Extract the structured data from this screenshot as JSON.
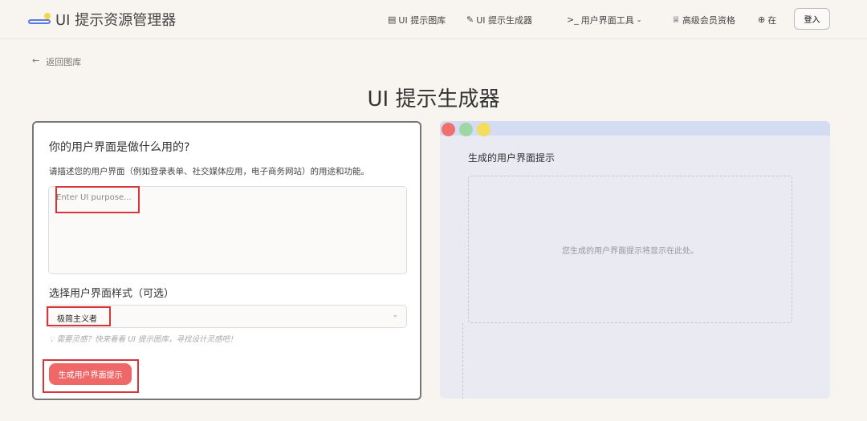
{
  "header": {
    "app_title": "UI 提示资源管理器",
    "nav": [
      {
        "label": "UI 提示图库",
        "icon": "gallery-icon"
      },
      {
        "label": "UI 提示生成器",
        "icon": "magic-icon"
      },
      {
        "label": "用户界面工具",
        "icon": "terminal-icon"
      },
      {
        "label": "高级会员资格",
        "icon": "crown-icon"
      },
      {
        "label": "在",
        "icon": "globe-icon"
      }
    ],
    "login": "登入"
  },
  "back": "返回图库",
  "page_title": "UI 提示生成器",
  "form": {
    "question": "你的用户界面是做什么用的?",
    "description": "请描述您的用户界面（例如登录表单、社交媒体应用，电子商务网站）的用途和功能。",
    "purpose_placeholder": "Enter UI purpose...",
    "style_label": "选择用户界面样式（可选）",
    "style_value": "极简主义者",
    "hint": "需要灵感？快来看看 UI 提示图库，寻找设计灵感吧！",
    "generate": "生成用户界面提示"
  },
  "output": {
    "title": "生成的用户界面提示",
    "placeholder": "您生成的用户界面提示将显示在此处。"
  },
  "colors": {
    "accent": "#ef6767",
    "highlight": "#d9343a"
  }
}
